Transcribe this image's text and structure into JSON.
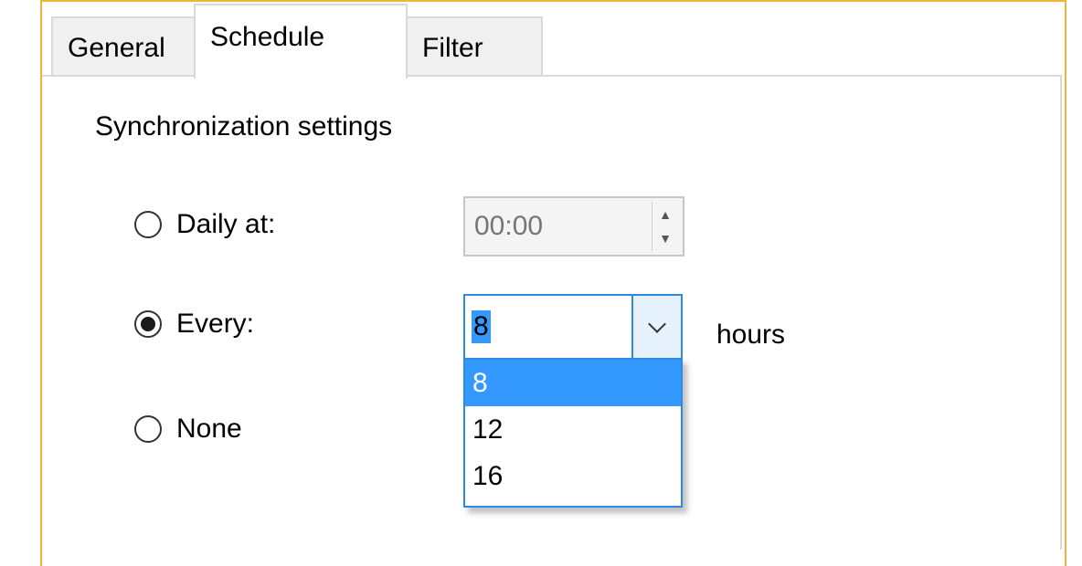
{
  "tabs": {
    "general": "General",
    "schedule": "Schedule",
    "filter": "Filter"
  },
  "group": {
    "title": "Synchronization settings"
  },
  "options": {
    "daily_label": "Daily at:",
    "every_label": "Every:",
    "none_label": "None",
    "selected": "every"
  },
  "daily_time": {
    "value": "00:00",
    "enabled": false
  },
  "interval": {
    "value": "8",
    "unit": "hours",
    "dropdown_open": true,
    "items": [
      "8",
      "12",
      "16"
    ],
    "selected_item": "8"
  },
  "colors": {
    "focus_border": "#f0b43a",
    "highlight": "#3399ff"
  }
}
